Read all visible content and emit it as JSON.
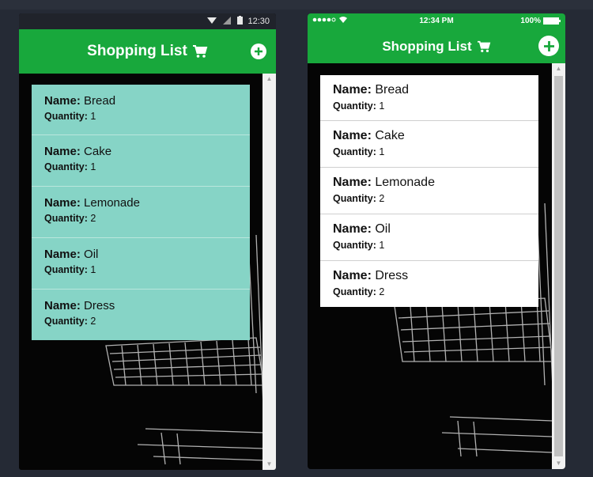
{
  "android": {
    "status": {
      "time": "12:30"
    },
    "header": {
      "title": "Shopping List",
      "cart_icon": "cart-icon",
      "add_icon": "plus-circle-icon"
    },
    "items": [
      {
        "name_label": "Name:",
        "name": "Bread",
        "qty_label": "Quantity:",
        "qty": "1"
      },
      {
        "name_label": "Name:",
        "name": "Cake",
        "qty_label": "Quantity:",
        "qty": "1"
      },
      {
        "name_label": "Name:",
        "name": "Lemonade",
        "qty_label": "Quantity:",
        "qty": "2"
      },
      {
        "name_label": "Name:",
        "name": "Oil",
        "qty_label": "Quantity:",
        "qty": "1"
      },
      {
        "name_label": "Name:",
        "name": "Dress",
        "qty_label": "Quantity:",
        "qty": "2"
      }
    ]
  },
  "ios": {
    "status": {
      "time": "12:34 PM",
      "battery": "100%"
    },
    "header": {
      "title": "Shopping List",
      "cart_icon": "cart-icon",
      "add_icon": "plus-circle-icon"
    },
    "items": [
      {
        "name_label": "Name:",
        "name": "Bread",
        "qty_label": "Quantity:",
        "qty": "1"
      },
      {
        "name_label": "Name:",
        "name": "Cake",
        "qty_label": "Quantity:",
        "qty": "1"
      },
      {
        "name_label": "Name:",
        "name": "Lemonade",
        "qty_label": "Quantity:",
        "qty": "2"
      },
      {
        "name_label": "Name:",
        "name": "Oil",
        "qty_label": "Quantity:",
        "qty": "1"
      },
      {
        "name_label": "Name:",
        "name": "Dress",
        "qty_label": "Quantity:",
        "qty": "2"
      }
    ]
  },
  "colors": {
    "header_green": "#18a83c",
    "android_list_bg": "#86d4c6",
    "ios_list_bg": "#ffffff",
    "page_bg": "#252a35"
  }
}
